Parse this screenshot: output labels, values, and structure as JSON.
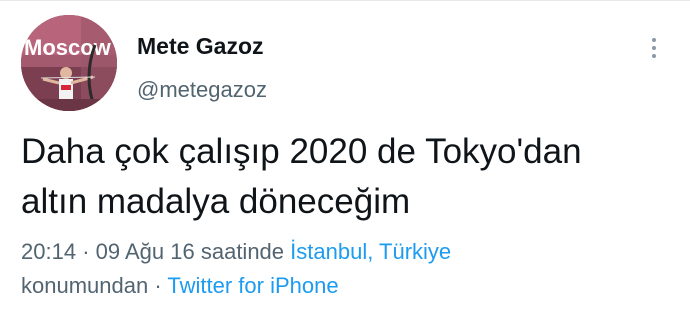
{
  "author": {
    "display_name": "Mete Gazoz",
    "handle": "@metegazoz",
    "avatar_banner_text": "Moscow"
  },
  "tweet": {
    "text_line_1": "Daha çok çalışıp 2020 de Tokyo'dan",
    "text_line_2": "altın madalya döneceğim"
  },
  "meta": {
    "time": "20:14",
    "separator": "·",
    "date_prefix": "09 Ağu 16 saatinde",
    "location": "İstanbul, Türkiye",
    "location_suffix": "konumundan",
    "source": "Twitter for iPhone"
  },
  "colors": {
    "link": "#1d9bf0",
    "secondary_text": "#536471",
    "primary_text": "#0f1419"
  },
  "icons": {
    "more": "more-vertical-icon"
  }
}
